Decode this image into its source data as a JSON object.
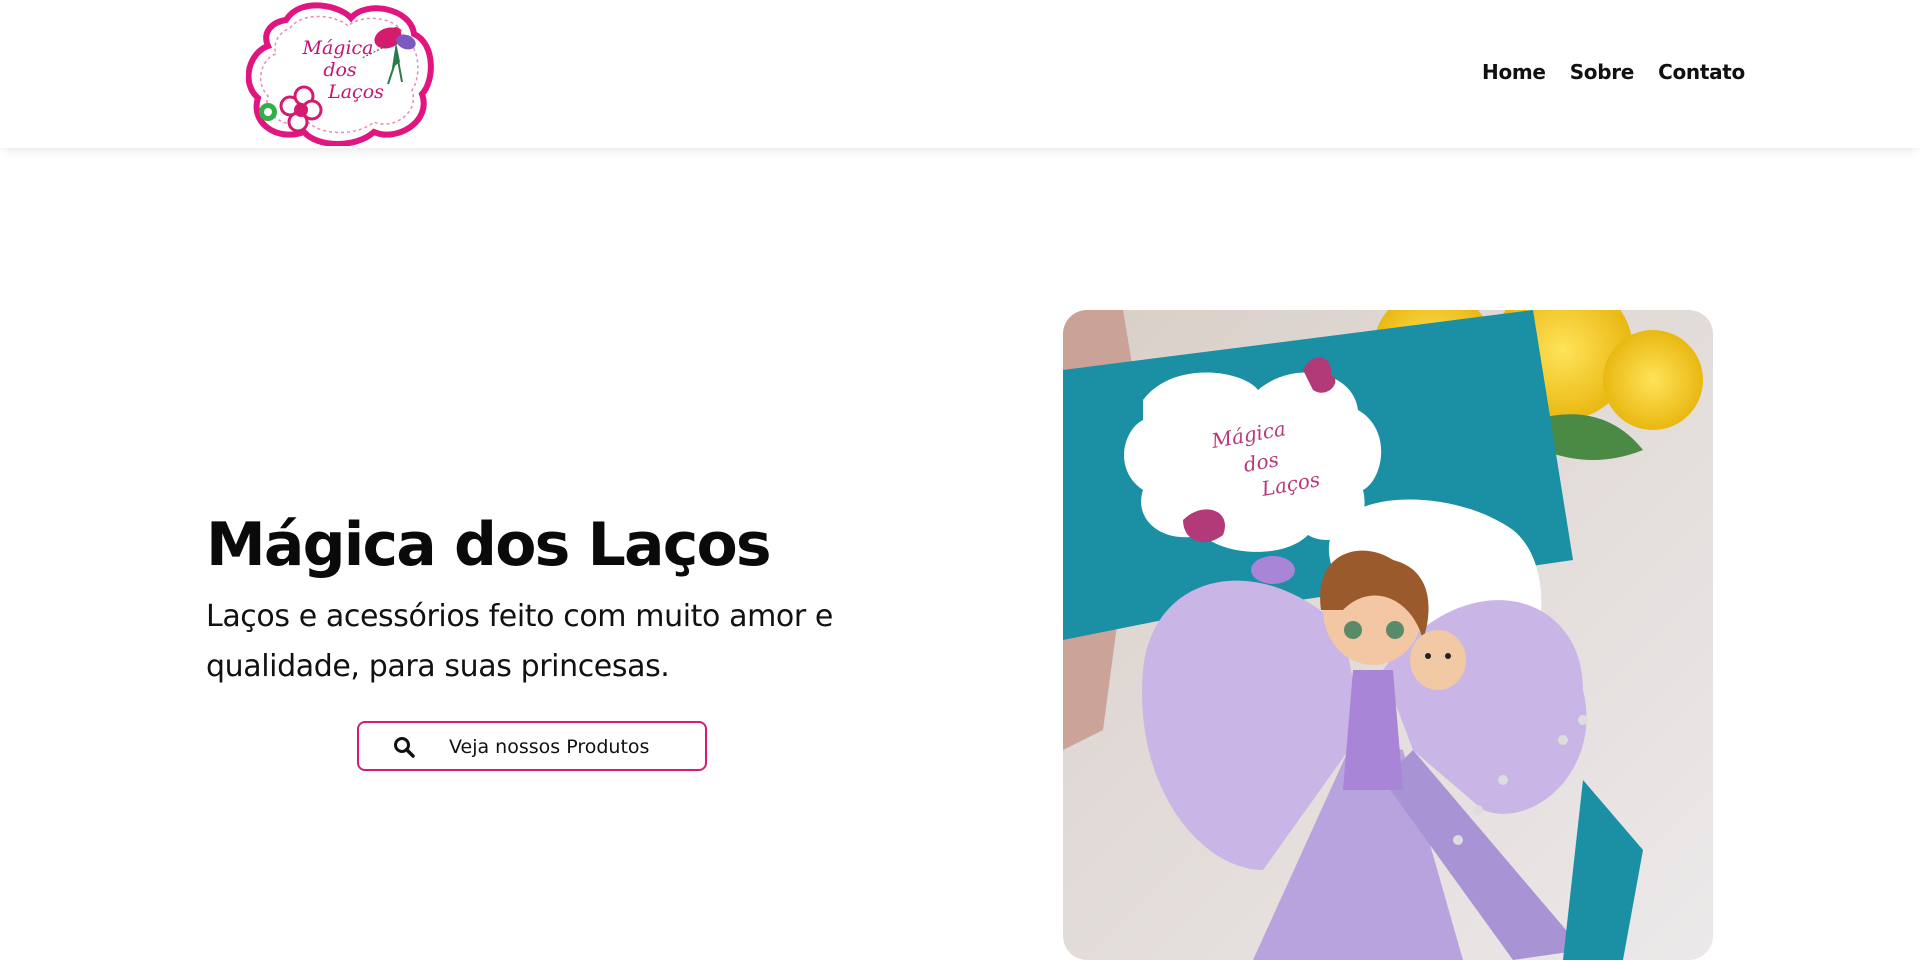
{
  "logo": {
    "line1": "Mágica",
    "line2": "dos",
    "line3": "Laços"
  },
  "nav": {
    "items": [
      {
        "label": "Home"
      },
      {
        "label": "Sobre"
      },
      {
        "label": "Contato"
      }
    ]
  },
  "hero": {
    "title": "Mágica dos Laços",
    "subtitle": "Laços e acessórios feito com muito amor e qualidade, para suas princesas.",
    "cta_label": "Veja nossos Produtos",
    "cta_icon": "search-icon"
  },
  "photo": {
    "card_line1": "Mágica",
    "card_line2": "dos",
    "card_line3": "Laços"
  },
  "colors": {
    "brand_pink": "#d51c78",
    "teal": "#1b8fa4",
    "lilac": "#c9b6e6"
  }
}
